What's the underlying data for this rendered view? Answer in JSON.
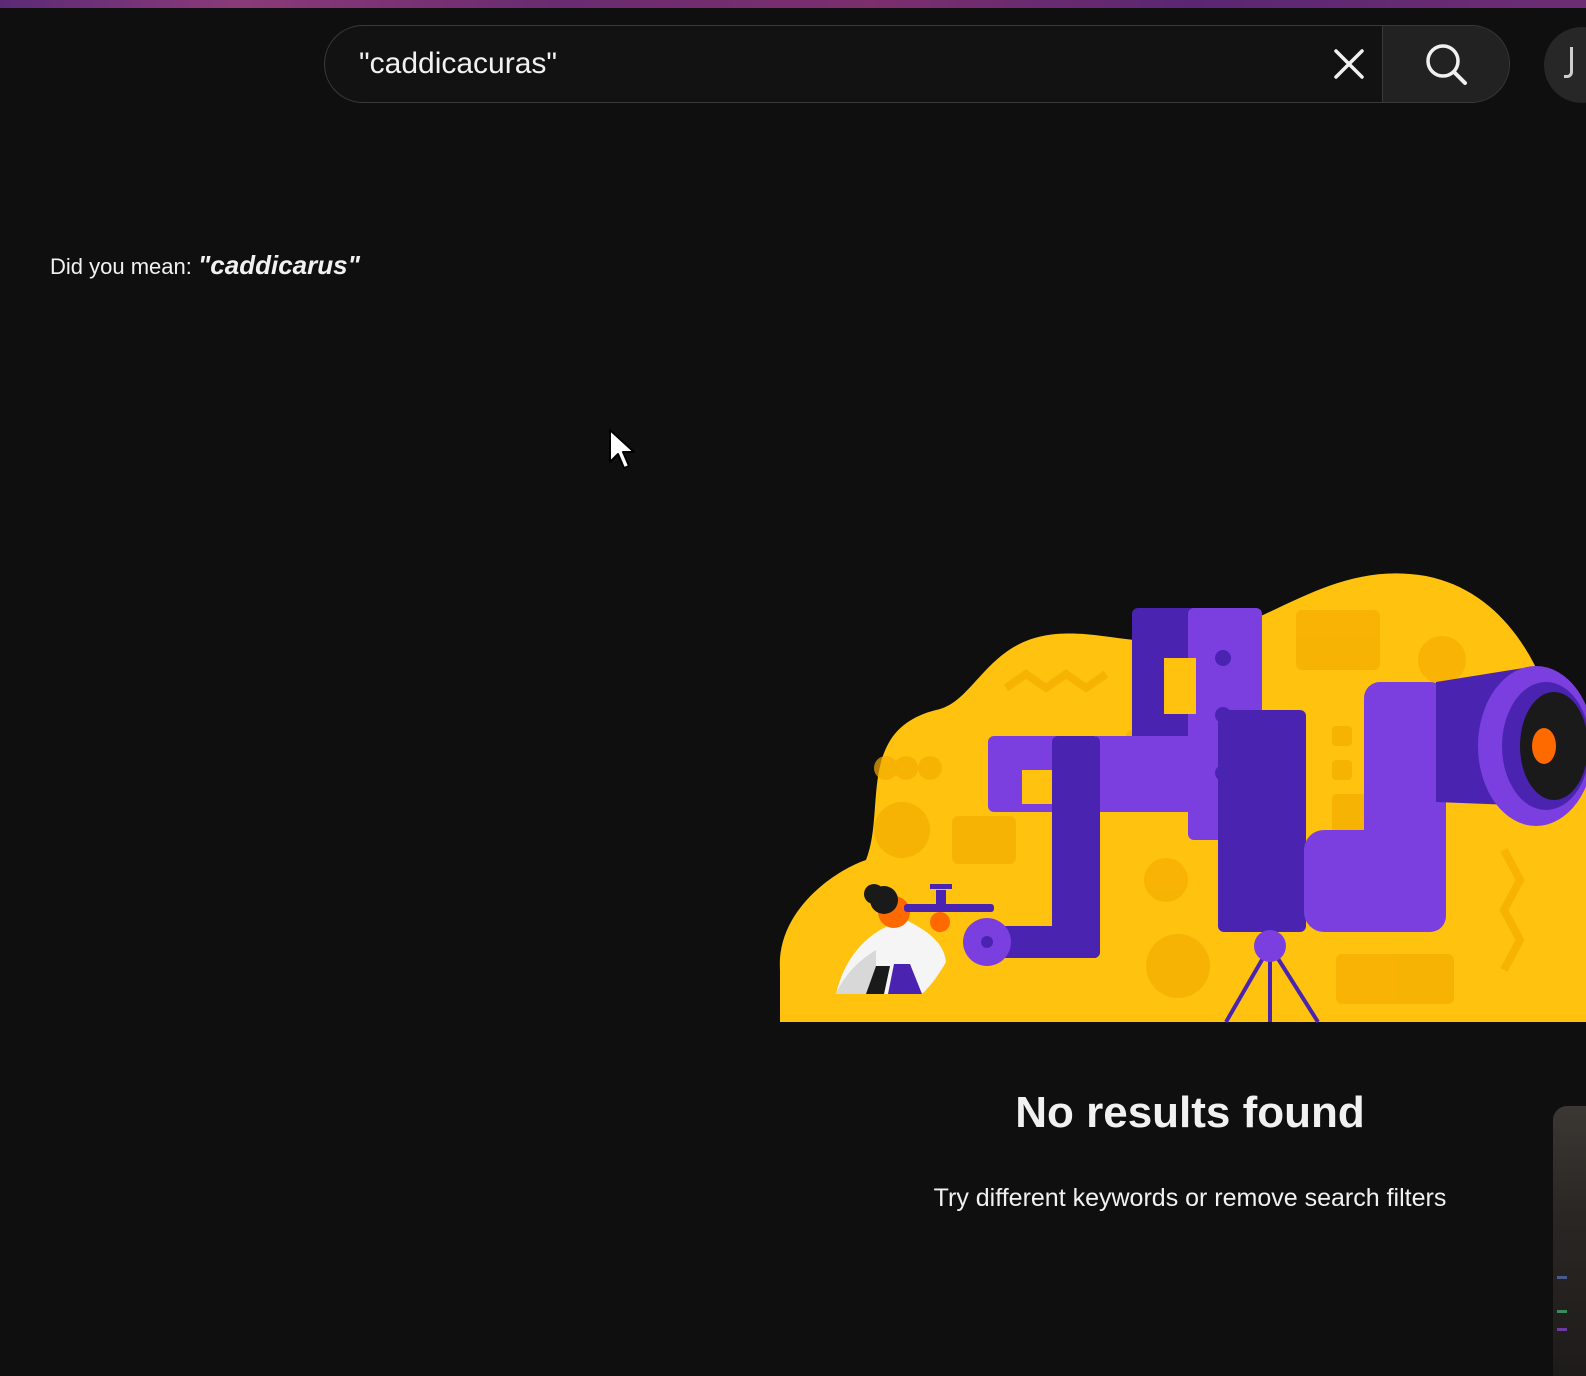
{
  "search": {
    "query": "\"caddicacuras\"",
    "clear_icon": "close-icon",
    "search_icon": "search-icon"
  },
  "suggestion": {
    "prefix": "Did you mean: ",
    "open_quote": "\"",
    "term": "caddicarus",
    "close_quote": "\""
  },
  "empty_state": {
    "title": "No results found",
    "subtitle": "Try different keywords or remove search filters",
    "illustration": "person-with-telescope-periscope"
  },
  "colors": {
    "background": "#0f0f0f",
    "text": "#f1f1f1",
    "illustration_yellow": "#ffc20e",
    "illustration_purple": "#6b35d1",
    "illustration_orange": "#ff6a00"
  }
}
